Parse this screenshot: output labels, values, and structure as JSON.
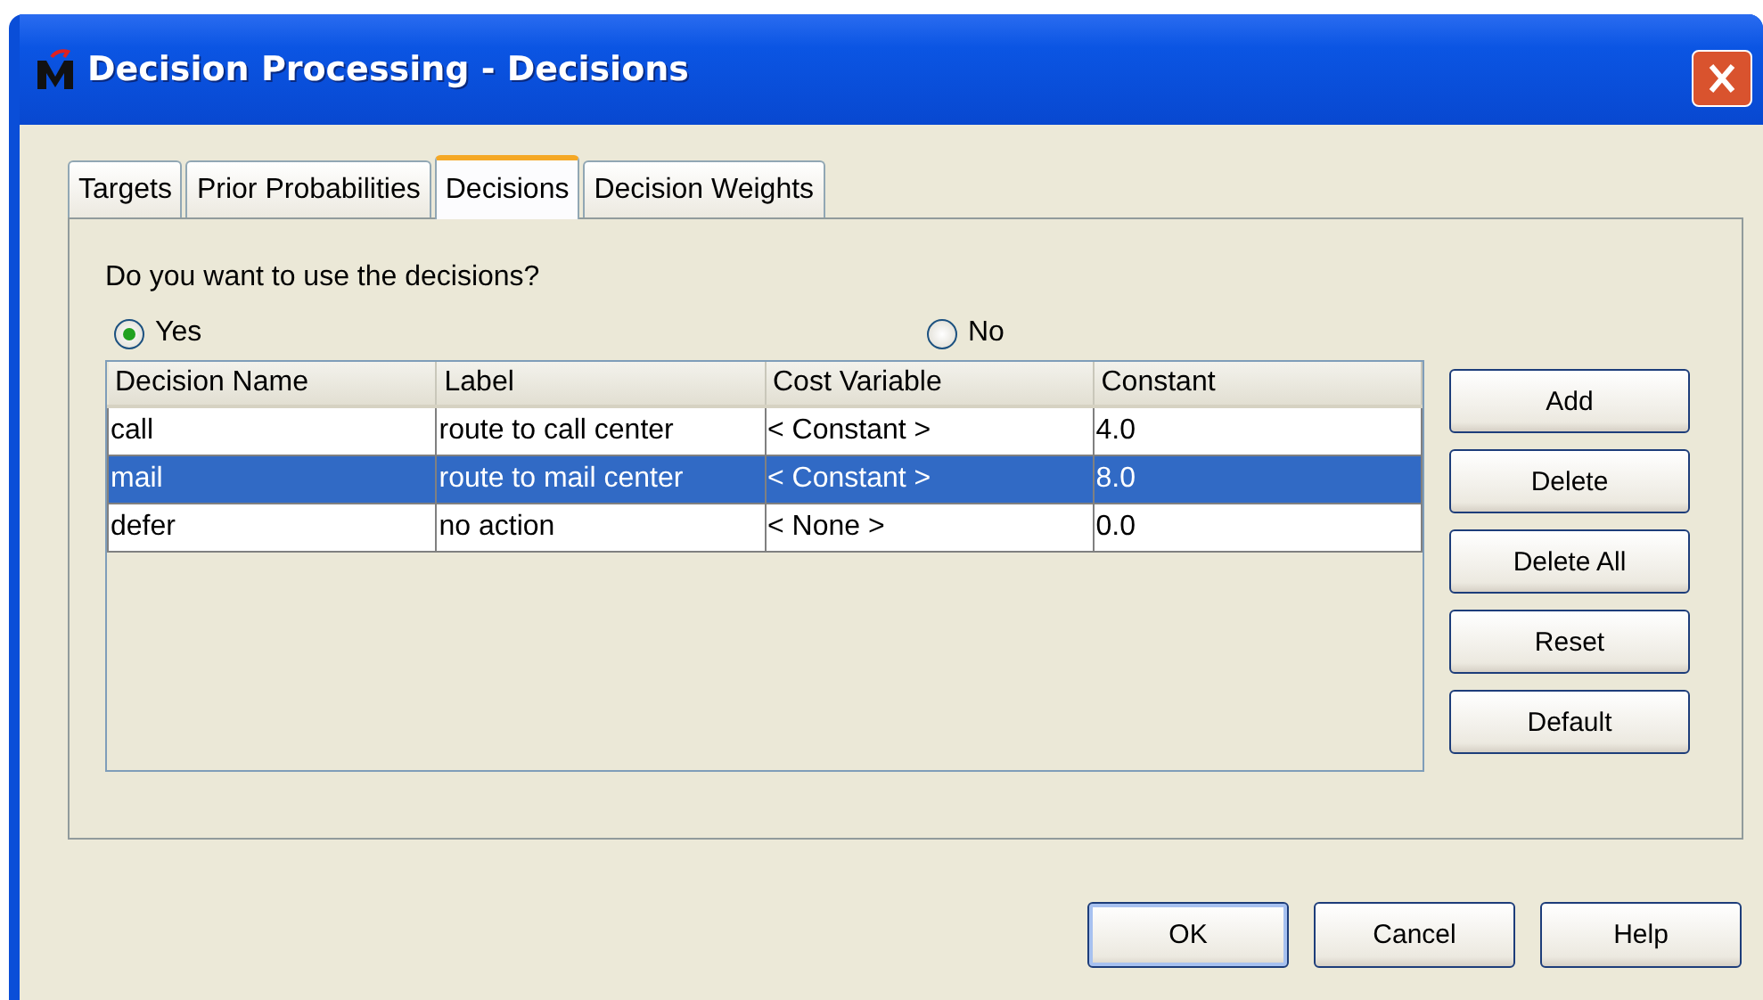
{
  "window": {
    "title": "Decision Processing - Decisions"
  },
  "tabs": [
    {
      "label": "Targets",
      "selected": false
    },
    {
      "label": "Prior Probabilities",
      "selected": false
    },
    {
      "label": "Decisions",
      "selected": true
    },
    {
      "label": "Decision Weights",
      "selected": false
    }
  ],
  "question": "Do you want to use the decisions?",
  "options": [
    {
      "label": "Yes",
      "selected": true
    },
    {
      "label": "No",
      "selected": false
    }
  ],
  "table": {
    "columns": [
      "Decision Name",
      "Label",
      "Cost Variable",
      "Constant"
    ],
    "rows": [
      {
        "cells": [
          "call",
          "route to call center",
          "< Constant >",
          "4.0"
        ],
        "selected": false
      },
      {
        "cells": [
          "mail",
          "route to mail center",
          "< Constant >",
          "8.0"
        ],
        "selected": true
      },
      {
        "cells": [
          "defer",
          "no action",
          "< None >",
          "0.0"
        ],
        "selected": false
      }
    ]
  },
  "side_buttons": [
    "Add",
    "Delete",
    "Delete All",
    "Reset",
    "Default"
  ],
  "buttons": [
    {
      "label": "OK",
      "default": true
    },
    {
      "label": "Cancel",
      "default": false
    },
    {
      "label": "Help",
      "default": false
    }
  ]
}
